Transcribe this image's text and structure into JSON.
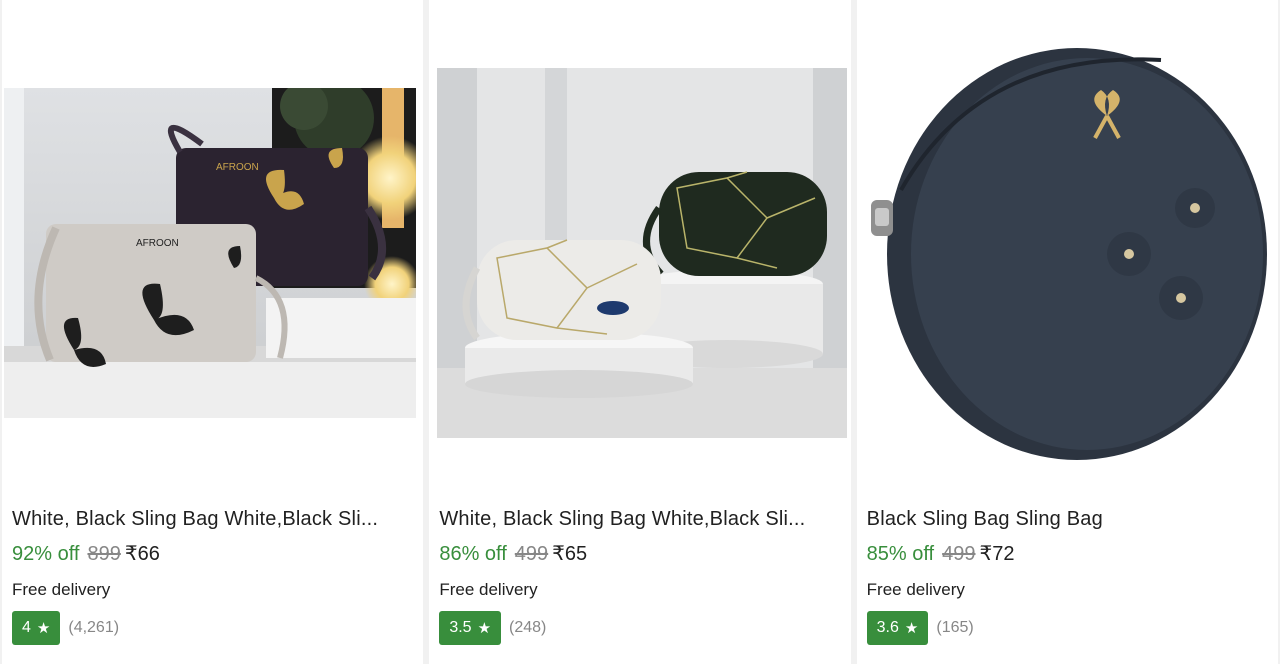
{
  "products": [
    {
      "title": "White, Black Sling Bag White,Black Sli...",
      "discount": "92% off",
      "mrp": "899",
      "price": "₹66",
      "delivery": "Free delivery",
      "rating": "4",
      "rating_count": "(4,261)",
      "star_icon": "star-icon",
      "image_alt": "white and black butterfly print sling bags"
    },
    {
      "title": "White, Black Sling Bag White,Black Sli...",
      "discount": "86% off",
      "mrp": "499",
      "price": "₹65",
      "delivery": "Free delivery",
      "rating": "3.5",
      "rating_count": "(248)",
      "star_icon": "star-icon",
      "image_alt": "white and dark green geometric sling bags on pedestals"
    },
    {
      "title": "Black Sling Bag Sling Bag",
      "discount": "85% off",
      "mrp": "499",
      "price": "₹72",
      "delivery": "Free delivery",
      "rating": "3.6",
      "rating_count": "(165)",
      "star_icon": "star-icon",
      "image_alt": "round black sling bag with flower details"
    }
  ],
  "colors": {
    "discount": "#388e3c",
    "rating_badge": "#388e3c",
    "muted": "#878787",
    "text": "#212121"
  }
}
